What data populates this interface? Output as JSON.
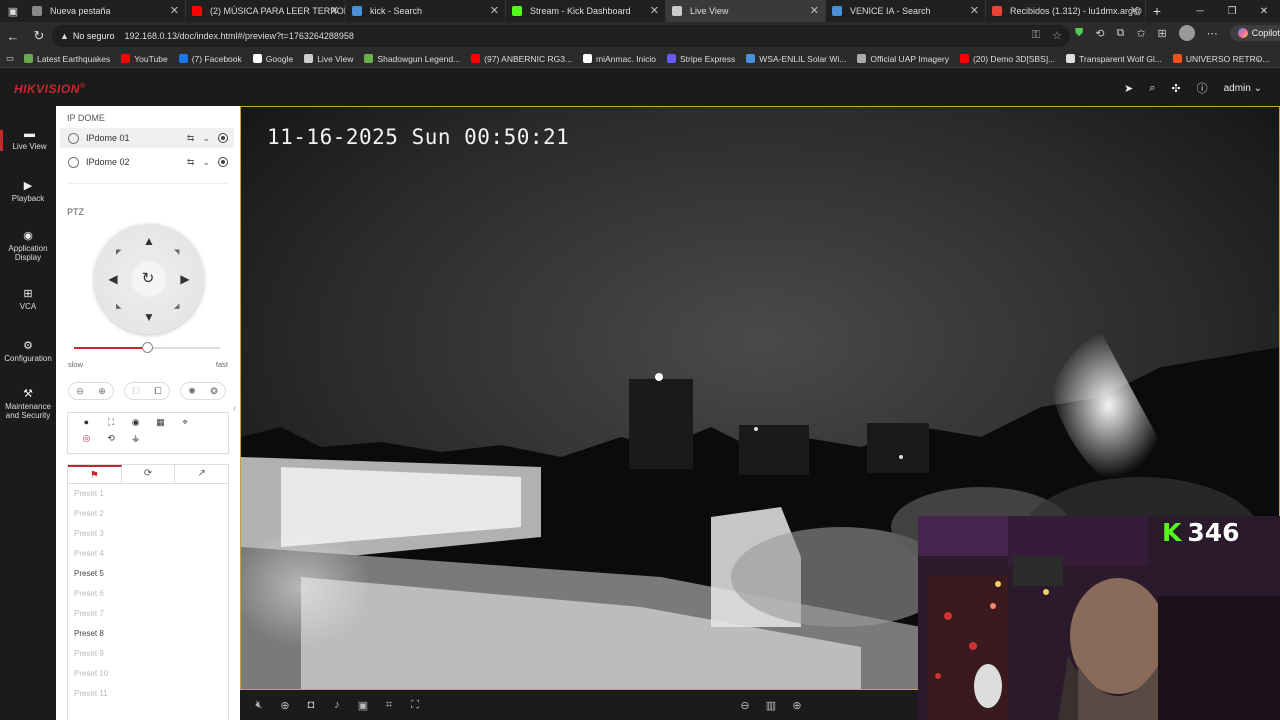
{
  "browser": {
    "tabs": [
      {
        "title": "Nueva pestaña",
        "color": "#888888"
      },
      {
        "title": "(2) MÚSICA PARA LEER TERROR Y",
        "color": "#ff0000"
      },
      {
        "title": "kick - Search",
        "color": "#4a90d9"
      },
      {
        "title": "Stream - Kick Dashboard",
        "color": "#53fc18"
      },
      {
        "title": "Live View",
        "color": "#cccccc"
      },
      {
        "title": "VENICE IA - Search",
        "color": "#4a90d9"
      },
      {
        "title": "Recibidos (1.312) - lu1dmx.arg@",
        "color": "#ea4335"
      }
    ],
    "security_label": "No seguro",
    "url": "192.168.0.13/doc/index.html#/preview?t=1763264288958",
    "copilot_label": "Copilot",
    "bookmarks": [
      {
        "label": "Latest Earthquakes",
        "color": "#6aa84f"
      },
      {
        "label": "YouTube",
        "color": "#ff0000"
      },
      {
        "label": "(7) Facebook",
        "color": "#1877f2"
      },
      {
        "label": "Google",
        "color": "#ffffff"
      },
      {
        "label": "Live View",
        "color": "#cccccc"
      },
      {
        "label": "Shadowgun Legend...",
        "color": "#6ab04c"
      },
      {
        "label": "(97) ANBERNIC RG3...",
        "color": "#ff0000"
      },
      {
        "label": "miAnmac. Inicio",
        "color": "#ffffff"
      },
      {
        "label": "Stripe Express",
        "color": "#635bff"
      },
      {
        "label": "WSA-ENLIL Solar Wi...",
        "color": "#4a90d9"
      },
      {
        "label": "Official UAP Imagery",
        "color": "#aaaaaa"
      },
      {
        "label": "(20) Demo 3D[SBS]...",
        "color": "#ff0000"
      },
      {
        "label": "Transparent Wolf Gl...",
        "color": "#dddddd"
      },
      {
        "label": "UNIVERSO RETRO...",
        "color": "#f4511e"
      }
    ]
  },
  "app": {
    "brand": "HIKVISION",
    "brand_reg": "®",
    "user": "admin",
    "nav": [
      {
        "label": "Live View",
        "icon": "live-view-icon"
      },
      {
        "label": "Playback",
        "icon": "playback-icon"
      },
      {
        "label": "Application Display",
        "icon": "application-icon"
      },
      {
        "label": "VCA",
        "icon": "vca-icon"
      },
      {
        "label": "Configuration",
        "icon": "gear-icon"
      },
      {
        "label": "Maintenance and Security",
        "icon": "maintenance-icon"
      }
    ]
  },
  "panel": {
    "group_title": "IP DOME",
    "cameras": [
      {
        "name": "IPdome 01",
        "selected": true
      },
      {
        "name": "IPdome 02",
        "selected": false
      }
    ],
    "ptz_title": "PTZ",
    "speed": {
      "min_label": "slow",
      "max_label": "fast",
      "level": 0.5
    },
    "preset_tab_active": "presets",
    "presets": [
      {
        "label": "Preset 1",
        "set": false
      },
      {
        "label": "Preset 2",
        "set": false
      },
      {
        "label": "Preset 3",
        "set": false
      },
      {
        "label": "Preset 4",
        "set": false
      },
      {
        "label": "Preset 5",
        "set": true
      },
      {
        "label": "Preset 6",
        "set": false
      },
      {
        "label": "Preset 7",
        "set": false
      },
      {
        "label": "Preset 8",
        "set": true
      },
      {
        "label": "Preset 9",
        "set": false
      },
      {
        "label": "Preset 10",
        "set": false
      },
      {
        "label": "Preset 11",
        "set": false
      }
    ]
  },
  "video": {
    "osd": "11-16-2025 Sun 00:50:21"
  },
  "overlay": {
    "kick_viewers": "346",
    "kick_color": "#53fc18"
  },
  "colors": {
    "accent": "#c8262d",
    "video_border": "#c8a23a"
  }
}
